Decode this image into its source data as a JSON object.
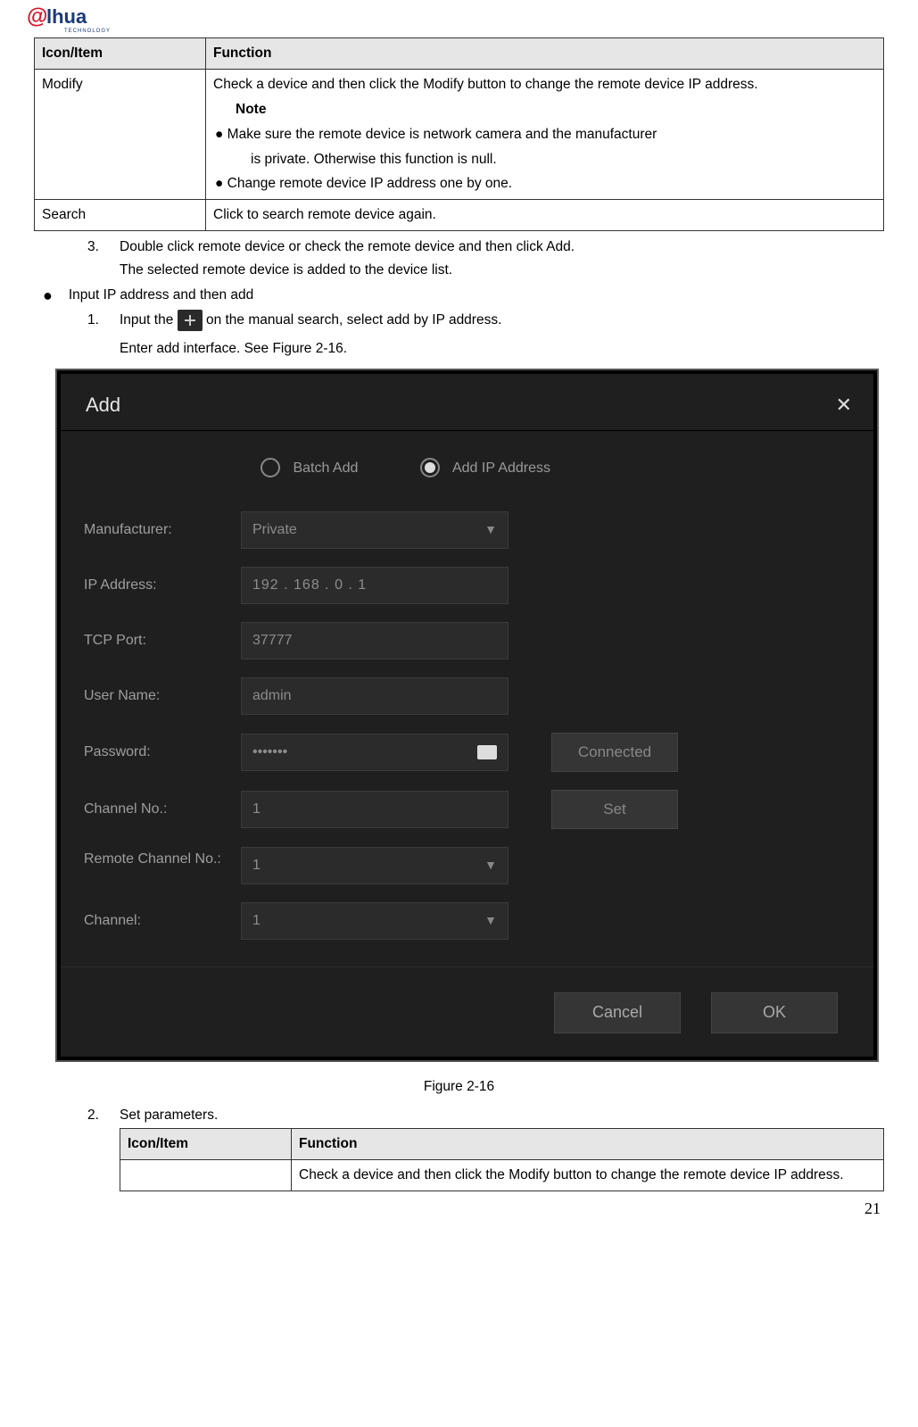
{
  "logo": {
    "name": "alhua",
    "sub": "TECHNOLOGY"
  },
  "table1": {
    "head": {
      "c1": "Icon/Item",
      "c2": "Function"
    },
    "row_modify": {
      "label": "Modify",
      "desc1": "Check a device and then click the Modify button to change the remote device IP address.",
      "note_title": "Note",
      "note1": "● Make sure the remote device is network camera and the manufacturer",
      "note1_sub": "is private. Otherwise this function is null.",
      "note2": "● Change remote device IP address one by one."
    },
    "row_search": {
      "label": "Search",
      "desc": "Click to search remote device again."
    }
  },
  "step3a": "Double click remote device or check the remote device and then click Add.",
  "step3b": "The selected remote device is added to the device list.",
  "bullet_input": "Input IP address and then add",
  "step1a_pre": "Input the ",
  "step1a_post": " on the manual search, select add by IP address.",
  "step1b": "Enter add interface. See Figure 2-16.",
  "dialog": {
    "title": "Add",
    "radio1": "Batch Add",
    "radio2": "Add IP Address",
    "fields": {
      "manufacturer_lbl": "Manufacturer:",
      "manufacturer_val": "Private",
      "ip_lbl": "IP Address:",
      "ip_val": "192  .   168  .    0   .    1",
      "port_lbl": "TCP Port:",
      "port_val": "37777",
      "user_lbl": "User Name:",
      "user_val": "admin",
      "pw_lbl": "Password:",
      "pw_val": "•••••••",
      "connected": "Connected",
      "chno_lbl": "Channel No.:",
      "chno_val": "1",
      "set": "Set",
      "rchno_lbl": "Remote Channel No.:",
      "rchno_val": "1",
      "ch_lbl": "Channel:",
      "ch_val": "1"
    },
    "cancel": "Cancel",
    "ok": "OK"
  },
  "figcap": "Figure 2-16",
  "step2": "Set parameters.",
  "table2": {
    "head": {
      "c1": "Icon/Item",
      "c2": "Function"
    },
    "row1_desc": "Check a device and then click the Modify button to change the remote device IP address."
  },
  "page": "21"
}
